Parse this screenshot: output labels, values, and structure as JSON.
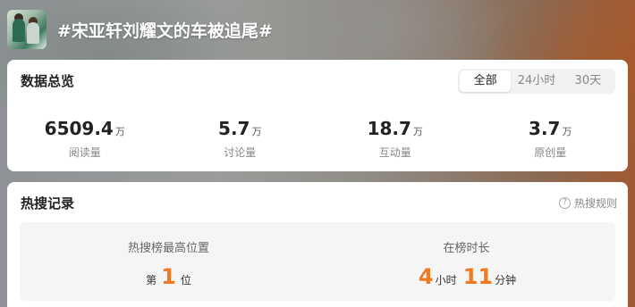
{
  "topic": {
    "title": "#宋亚轩刘耀文的车被追尾#"
  },
  "overview": {
    "title": "数据总览",
    "tabs": [
      {
        "label": "全部",
        "active": true
      },
      {
        "label": "24小时",
        "active": false
      },
      {
        "label": "30天",
        "active": false
      }
    ],
    "stats": [
      {
        "value": "6509.4",
        "unit": "万",
        "label": "阅读量"
      },
      {
        "value": "5.7",
        "unit": "万",
        "label": "讨论量"
      },
      {
        "value": "18.7",
        "unit": "万",
        "label": "互动量"
      },
      {
        "value": "3.7",
        "unit": "万",
        "label": "原创量"
      }
    ]
  },
  "hot_search": {
    "title": "热搜记录",
    "rules_label": "热搜规则",
    "rules_icon": "question-circle-icon",
    "highest_position": {
      "label": "热搜榜最高位置",
      "prefix": "第",
      "value": "1",
      "suffix": "位"
    },
    "duration": {
      "label": "在榜时长",
      "hours": "4",
      "hours_unit": "小时",
      "minutes": "11",
      "minutes_unit": "分钟"
    }
  },
  "colors": {
    "accent": "#f07a22",
    "card_bg": "#ffffff",
    "record_bg": "#f5f5f5"
  }
}
